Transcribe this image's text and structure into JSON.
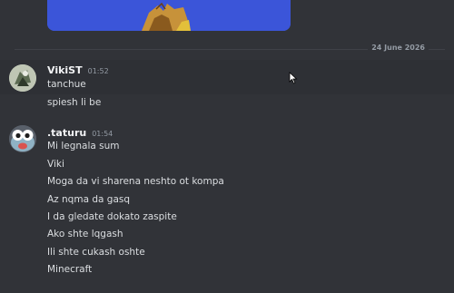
{
  "date_divider": "24 June 2026",
  "messages": [
    {
      "username": "VikiST",
      "time": "01:52",
      "lines": [
        "tanchue",
        "spiesh li be"
      ]
    },
    {
      "username": ".taturu",
      "time": "01:54",
      "lines": [
        "Mi legnala sum",
        "Viki",
        "Moga da vi sharena neshto ot kompa",
        "Az nqma da gasq",
        "I da gledate dokato zaspite",
        "Ako shte lqgash",
        "Ili shte cukash oshte",
        "Minecraft"
      ]
    }
  ],
  "colors": {
    "background": "#313338",
    "hover": "#2e3035",
    "username": "#f2f3f5",
    "text": "#dbdee1",
    "muted": "#949ba4",
    "embed": "#3b55d9"
  }
}
